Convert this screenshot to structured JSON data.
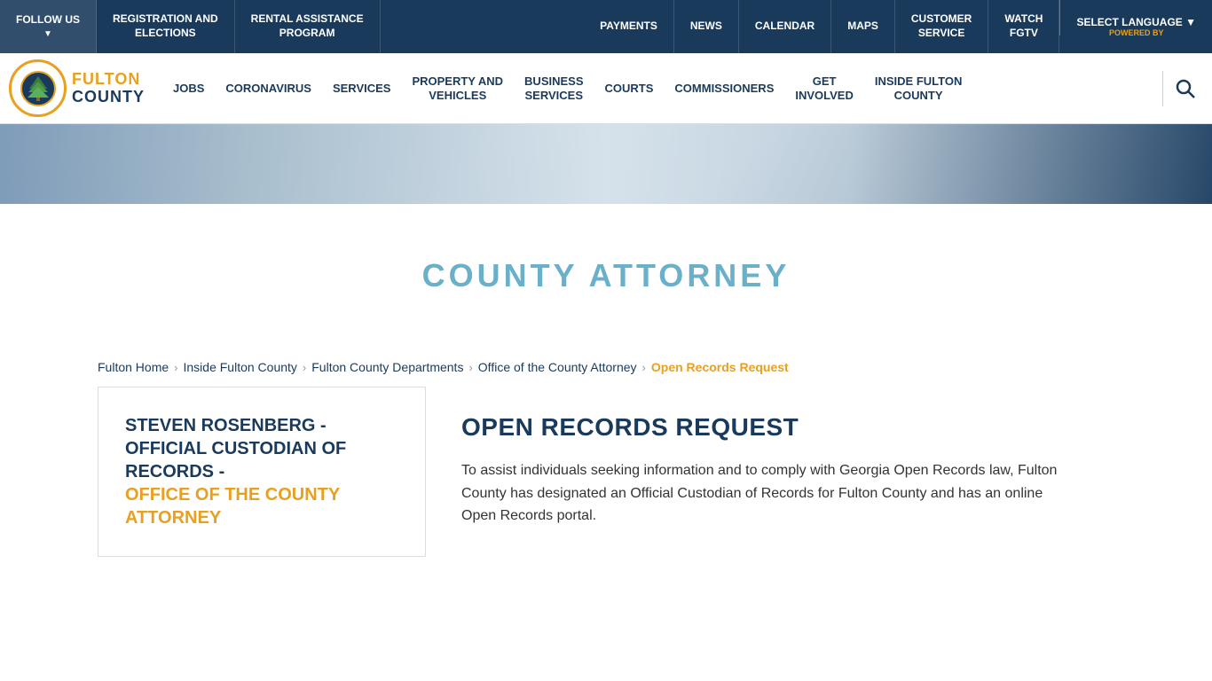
{
  "topBar": {
    "items": [
      {
        "id": "follow-us",
        "label": "FOLLOW US",
        "hasChevron": true
      },
      {
        "id": "registration-elections",
        "label": "REGISTRATION AND ELECTIONS",
        "hasChevron": false
      },
      {
        "id": "rental-assistance",
        "label": "RENTAL ASSISTANCE PROGRAM",
        "hasChevron": false
      },
      {
        "id": "payments",
        "label": "PAYMENTS",
        "hasChevron": false
      },
      {
        "id": "news",
        "label": "NEWS",
        "hasChevron": false
      },
      {
        "id": "calendar",
        "label": "CALENDAR",
        "hasChevron": false
      },
      {
        "id": "maps",
        "label": "MAPS",
        "hasChevron": false
      },
      {
        "id": "customer-service",
        "label": "CUSTOMER SERVICE",
        "hasChevron": false
      },
      {
        "id": "watch-fgtv",
        "label": "WATCH FGTV",
        "hasChevron": false
      }
    ],
    "language": {
      "label": "SELECT LANGUAGE",
      "poweredBy": "POWERED BY"
    }
  },
  "logo": {
    "fulton": "FULTON",
    "county": "COUNTY"
  },
  "mainNav": {
    "items": [
      {
        "id": "jobs",
        "label": "JOBS",
        "twoLine": false
      },
      {
        "id": "coronavirus",
        "label": "CORONAVIRUS",
        "twoLine": false
      },
      {
        "id": "services",
        "label": "SERVICES",
        "twoLine": false
      },
      {
        "id": "property-vehicles",
        "label1": "PROPERTY AND",
        "label2": "VEHICLES",
        "twoLine": true
      },
      {
        "id": "business-services",
        "label1": "BUSINESS",
        "label2": "SERVICES",
        "twoLine": true
      },
      {
        "id": "courts",
        "label": "COURTS",
        "twoLine": false
      },
      {
        "id": "commissioners",
        "label": "COMMISSIONERS",
        "twoLine": false
      },
      {
        "id": "get-involved",
        "label1": "GET",
        "label2": "INVOLVED",
        "twoLine": true
      },
      {
        "id": "inside-fulton-county",
        "label1": "INSIDE FULTON",
        "label2": "COUNTY",
        "twoLine": true
      }
    ]
  },
  "pageTitle": "COUNTY ATTORNEY",
  "breadcrumb": {
    "items": [
      {
        "id": "fulton-home",
        "label": "Fulton Home",
        "active": false
      },
      {
        "id": "inside-fulton-county",
        "label": "Inside Fulton County",
        "active": false
      },
      {
        "id": "fulton-county-departments",
        "label": "Fulton County Departments",
        "active": false
      },
      {
        "id": "office-county-attorney",
        "label": "Office of the County Attorney",
        "active": false
      },
      {
        "id": "open-records-request",
        "label": "Open Records Request",
        "active": true
      }
    ]
  },
  "sidebar": {
    "title": "STEVEN ROSENBERG -\nOFFICIAL CUSTODIAN OF RECORDS -\nOFFICE OF THE COUNTY ATTORNEY"
  },
  "mainContent": {
    "title": "OPEN RECORDS REQUEST",
    "text": "To assist individuals seeking information and to comply with Georgia Open Records law, Fulton County has designated an Official Custodian of Records for Fulton County and has an online Open Records portal."
  }
}
